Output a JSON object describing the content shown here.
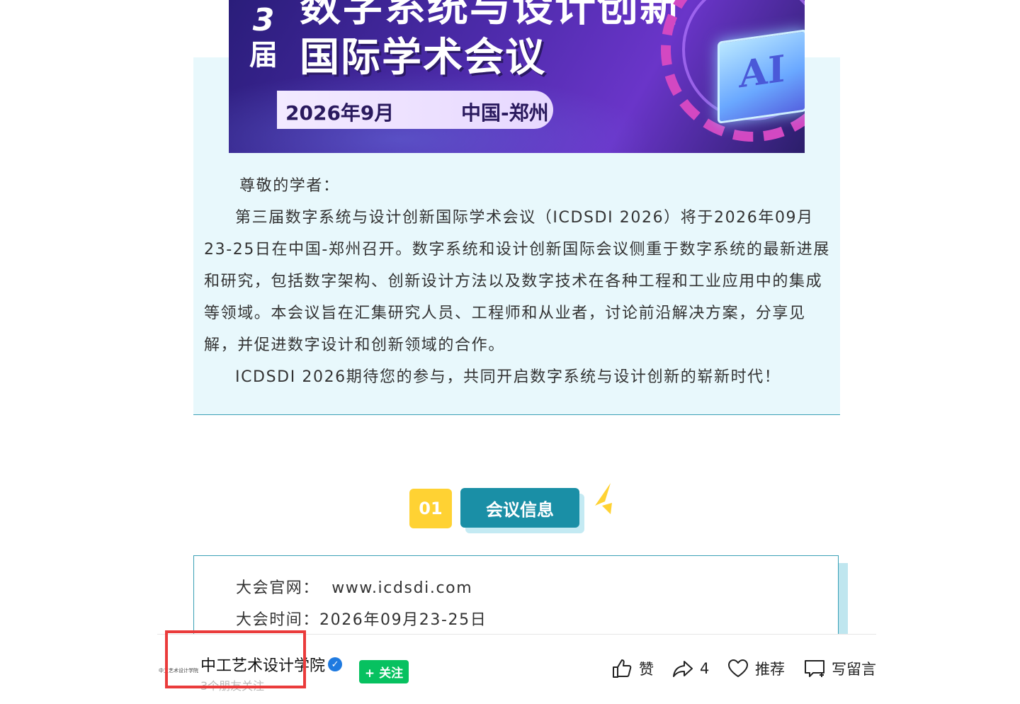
{
  "banner": {
    "edition_num": "3",
    "edition_char": "届",
    "title_line1": "数字系统与设计创新",
    "title_line2": "国际学术会议",
    "date": "2026年9月",
    "place": "中国-郑州",
    "chip_label": "AI"
  },
  "intro": {
    "greeting": "尊敬的学者：",
    "para1": "第三届数字系统与设计创新国际学术会议（ICDSDI 2026）将于2026年09月23-25日在中国-郑州召开。数字系统和设计创新国际会议侧重于数字系统的最新进展和研究，包括数字架构、创新设计方法以及数字技术在各种工程和工业应用中的集成等领域。本会议旨在汇集研究人员、工程师和从业者，讨论前沿解决方案，分享见解，并促进数字设计和创新领域的合作。",
    "para2": "ICDSDI 2026期待您的参与，共同开启数字系统与设计创新的崭新时代！"
  },
  "section": {
    "number": "01",
    "title": "会议信息"
  },
  "info": {
    "website_label": "大会官网：",
    "website_value": "www.icdsdi.com",
    "time_label": "大会时间：",
    "time_value": "2026年09月23-25日"
  },
  "account": {
    "name": "中工艺术设计学院",
    "friends": "3个朋友关注",
    "follow_label": "+ 关注",
    "avatar_text": "中工艺术设计学院"
  },
  "actions": {
    "like_label": "赞",
    "share_count": "4",
    "recommend_label": "推荐",
    "comment_label": "写留言"
  },
  "colors": {
    "accent_teal": "#1a8fa6",
    "accent_yellow": "#ffd233",
    "follow_green": "#07c160",
    "highlight_red": "#ea3b3b",
    "intro_bg": "#e8f8fc"
  }
}
